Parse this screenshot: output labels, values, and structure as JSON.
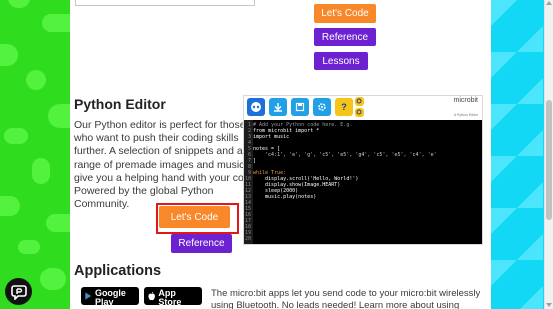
{
  "top_buttons": {
    "lets_code": "Let's Code",
    "reference": "Reference",
    "lessons": "Lessons"
  },
  "python_editor": {
    "title": "Python Editor",
    "description": "Our Python editor is perfect for those who want to push their coding skills further. A selection of snippets and a range of premade images and music give you a helping hand with your code. Powered by the global Python Community.",
    "lets_code": "Let's Code",
    "reference": "Reference"
  },
  "editor_preview": {
    "brand": "microbit",
    "sublabel": "A Python Editor",
    "code_lines": [
      {
        "n": "1",
        "text": "# Add your Python code here. E.g.",
        "color": "#9a9a9a"
      },
      {
        "n": "2",
        "text": "from microbit import *",
        "color": "#ffffff"
      },
      {
        "n": "3",
        "text": "import music",
        "color": "#ffffff"
      },
      {
        "n": "4",
        "text": "",
        "color": "#ffffff"
      },
      {
        "n": "5",
        "text": "notes = [",
        "color": "#ffffff"
      },
      {
        "n": "6",
        "text": "    'c4:1', 'e', 'g', 'c5', 'e5', 'g4', 'c5', 'e5', 'c4', 'e'",
        "color": "#cfcfcf"
      },
      {
        "n": "7",
        "text": "]",
        "color": "#ffffff"
      },
      {
        "n": "8",
        "text": "",
        "color": "#ffffff"
      },
      {
        "n": "9",
        "text": "while True:",
        "color": "#e0a040"
      },
      {
        "n": "10",
        "text": "    display.scroll('Hello, World!')",
        "color": "#ffffff"
      },
      {
        "n": "11",
        "text": "    display.show(Image.HEART)",
        "color": "#ffffff"
      },
      {
        "n": "12",
        "text": "    sleep(2000)",
        "color": "#ffffff"
      },
      {
        "n": "13",
        "text": "    music.play(notes)",
        "color": "#ffffff"
      },
      {
        "n": "14",
        "text": "",
        "color": "#ffffff"
      },
      {
        "n": "15",
        "text": "",
        "color": "#ffffff"
      },
      {
        "n": "16",
        "text": "",
        "color": "#ffffff"
      },
      {
        "n": "17",
        "text": "",
        "color": "#ffffff"
      },
      {
        "n": "18",
        "text": "",
        "color": "#ffffff"
      },
      {
        "n": "19",
        "text": "",
        "color": "#ffffff"
      },
      {
        "n": "20",
        "text": "",
        "color": "#ffffff"
      }
    ]
  },
  "applications": {
    "title": "Applications",
    "google_play": {
      "small": "GET IT ON",
      "big": "Google Play"
    },
    "app_store": {
      "small": "Download on the",
      "big": "App Store"
    },
    "description": "The micro:bit apps let you send code to your micro:bit wirelessly using Bluetooth. No leads needed! Learn more about using"
  },
  "colors": {
    "orange": "#f8882a",
    "purple": "#6c22d0",
    "green": "#2fdc1e",
    "cyan": "#12d8f5",
    "focus": "#e01818"
  },
  "icons": [
    "download-icon",
    "gear-icon",
    "help-icon",
    "zoom-icon",
    "chat-icon",
    "google-play-icon",
    "apple-icon"
  ]
}
